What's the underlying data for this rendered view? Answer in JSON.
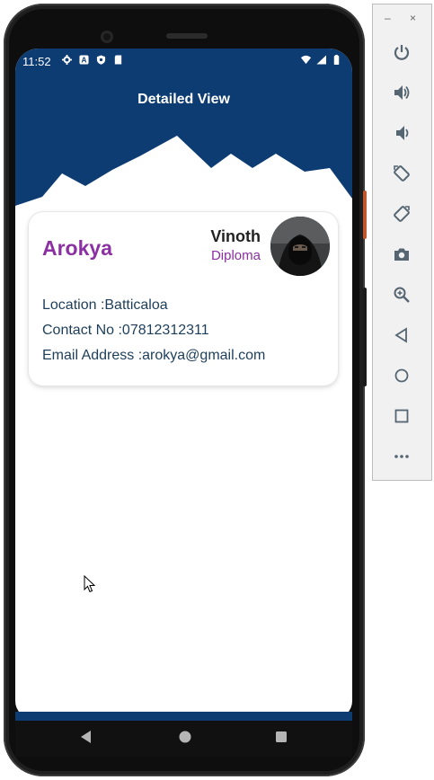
{
  "status_bar": {
    "time": "11:52"
  },
  "app": {
    "title": "Detailed View"
  },
  "card": {
    "name": "Arokya",
    "person_name": "Vinoth",
    "person_role": "Diploma",
    "location": "Location :Batticaloa",
    "contact": "Contact No :07812312311",
    "email": "Email Address :arokya@gmail.com"
  },
  "colors": {
    "header": "#0d3c73",
    "accent_purple": "#8b2fa3",
    "body_text": "#1d3e5a"
  },
  "toolbar": {
    "minimize": "–",
    "close": "×",
    "icons": [
      "power-icon",
      "volume-up-icon",
      "volume-down-icon",
      "rotate-left-icon",
      "rotate-right-icon",
      "camera-icon",
      "zoom-icon",
      "back-icon",
      "home-icon",
      "overview-icon",
      "more-icon"
    ]
  }
}
